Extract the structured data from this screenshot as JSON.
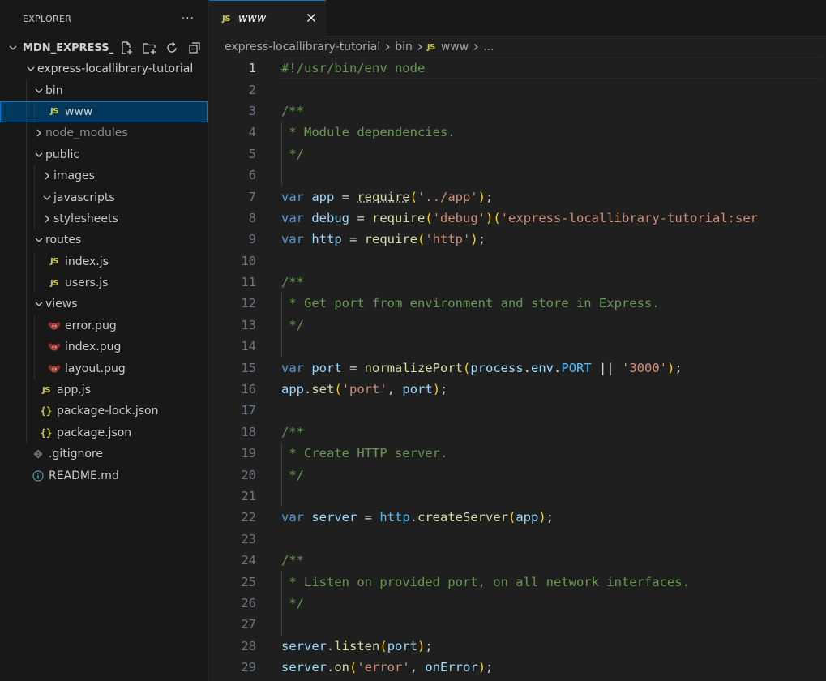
{
  "sidebar": {
    "title": "EXPLORER",
    "more_actions": "···",
    "workspace": {
      "name": "MDN_EXPRESS_...",
      "actions": [
        {
          "name": "new-file-icon"
        },
        {
          "name": "new-folder-icon"
        },
        {
          "name": "refresh-icon"
        },
        {
          "name": "collapse-all-icon"
        }
      ]
    },
    "tree": [
      {
        "label": "express-locallibrary-tutorial",
        "depth": 1,
        "kind": "folder",
        "open": true,
        "name": "express-locallibrary-tutorial"
      },
      {
        "label": "bin",
        "depth": 2,
        "kind": "folder",
        "open": true,
        "name": "bin"
      },
      {
        "label": "www",
        "depth": 3,
        "kind": "js",
        "selected": true,
        "name": "www"
      },
      {
        "label": "node_modules",
        "depth": 2,
        "kind": "folder",
        "open": false,
        "dim": true,
        "name": "node-modules"
      },
      {
        "label": "public",
        "depth": 2,
        "kind": "folder",
        "open": true,
        "name": "public"
      },
      {
        "label": "images",
        "depth": 3,
        "kind": "folder",
        "open": false,
        "name": "images"
      },
      {
        "label": "javascripts",
        "depth": 3,
        "kind": "folder",
        "open": true,
        "name": "javascripts"
      },
      {
        "label": "stylesheets",
        "depth": 3,
        "kind": "folder",
        "open": false,
        "name": "stylesheets"
      },
      {
        "label": "routes",
        "depth": 2,
        "kind": "folder",
        "open": true,
        "name": "routes"
      },
      {
        "label": "index.js",
        "depth": 3,
        "kind": "js",
        "name": "index-js"
      },
      {
        "label": "users.js",
        "depth": 3,
        "kind": "js",
        "name": "users-js"
      },
      {
        "label": "views",
        "depth": 2,
        "kind": "folder",
        "open": true,
        "name": "views"
      },
      {
        "label": "error.pug",
        "depth": 3,
        "kind": "pug",
        "name": "error-pug"
      },
      {
        "label": "index.pug",
        "depth": 3,
        "kind": "pug",
        "name": "index-pug"
      },
      {
        "label": "layout.pug",
        "depth": 3,
        "kind": "pug",
        "name": "layout-pug"
      },
      {
        "label": "app.js",
        "depth": 2,
        "kind": "js",
        "name": "app-js"
      },
      {
        "label": "package-lock.json",
        "depth": 2,
        "kind": "json",
        "name": "package-lock-json"
      },
      {
        "label": "package.json",
        "depth": 2,
        "kind": "json",
        "name": "package-json"
      },
      {
        "label": ".gitignore",
        "depth": 1,
        "kind": "git",
        "name": "gitignore"
      },
      {
        "label": "README.md",
        "depth": 1,
        "kind": "info",
        "name": "readme-md"
      }
    ]
  },
  "editor": {
    "tab": {
      "label": "www",
      "icon": "JS"
    },
    "breadcrumb": [
      "express-locallibrary-tutorial",
      "bin",
      "www",
      "..."
    ],
    "current_line": 1,
    "lines": [
      [
        [
          "#!/usr/bin/env node",
          "comment"
        ]
      ],
      [],
      [
        [
          "/**",
          "comment"
        ]
      ],
      [
        [
          " * Module dependencies.",
          "comment"
        ]
      ],
      [
        [
          " */",
          "comment"
        ]
      ],
      [],
      [
        [
          "var",
          "keyword"
        ],
        [
          " ",
          "plain"
        ],
        [
          "app",
          "var"
        ],
        [
          " = ",
          "plain"
        ],
        [
          "require",
          "func"
        ],
        [
          "(",
          "bracket1"
        ],
        [
          "'../app'",
          "string"
        ],
        [
          ")",
          "bracket1"
        ],
        [
          ";",
          "plain"
        ]
      ],
      [
        [
          "var",
          "keyword"
        ],
        [
          " ",
          "plain"
        ],
        [
          "debug",
          "var"
        ],
        [
          " = ",
          "plain"
        ],
        [
          "require",
          "func"
        ],
        [
          "(",
          "bracket1"
        ],
        [
          "'debug'",
          "string"
        ],
        [
          ")",
          "bracket1"
        ],
        [
          "(",
          "bracket1"
        ],
        [
          "'express-locallibrary-tutorial:ser",
          "string"
        ]
      ],
      [
        [
          "var",
          "keyword"
        ],
        [
          " ",
          "plain"
        ],
        [
          "http",
          "var"
        ],
        [
          " = ",
          "plain"
        ],
        [
          "require",
          "func"
        ],
        [
          "(",
          "bracket1"
        ],
        [
          "'http'",
          "string"
        ],
        [
          ")",
          "bracket1"
        ],
        [
          ";",
          "plain"
        ]
      ],
      [],
      [
        [
          "/**",
          "comment"
        ]
      ],
      [
        [
          " * Get port from environment and store in Express.",
          "comment"
        ]
      ],
      [
        [
          " */",
          "comment"
        ]
      ],
      [],
      [
        [
          "var",
          "keyword"
        ],
        [
          " ",
          "plain"
        ],
        [
          "port",
          "var"
        ],
        [
          " = ",
          "plain"
        ],
        [
          "normalizePort",
          "func"
        ],
        [
          "(",
          "bracket1"
        ],
        [
          "process",
          "var"
        ],
        [
          ".",
          "plain"
        ],
        [
          "env",
          "var"
        ],
        [
          ".",
          "plain"
        ],
        [
          "PORT",
          "const"
        ],
        [
          " || ",
          "plain"
        ],
        [
          "'3000'",
          "string"
        ],
        [
          ")",
          "bracket1"
        ],
        [
          ";",
          "plain"
        ]
      ],
      [
        [
          "app",
          "var"
        ],
        [
          ".",
          "plain"
        ],
        [
          "set",
          "func"
        ],
        [
          "(",
          "bracket1"
        ],
        [
          "'port'",
          "string"
        ],
        [
          ", ",
          "plain"
        ],
        [
          "port",
          "var"
        ],
        [
          ")",
          "bracket1"
        ],
        [
          ";",
          "plain"
        ]
      ],
      [],
      [
        [
          "/**",
          "comment"
        ]
      ],
      [
        [
          " * Create HTTP server.",
          "comment"
        ]
      ],
      [
        [
          " */",
          "comment"
        ]
      ],
      [],
      [
        [
          "var",
          "keyword"
        ],
        [
          " ",
          "plain"
        ],
        [
          "server",
          "var"
        ],
        [
          " = ",
          "plain"
        ],
        [
          "http",
          "const"
        ],
        [
          ".",
          "plain"
        ],
        [
          "createServer",
          "func"
        ],
        [
          "(",
          "bracket1"
        ],
        [
          "app",
          "var"
        ],
        [
          ")",
          "bracket1"
        ],
        [
          ";",
          "plain"
        ]
      ],
      [],
      [
        [
          "/**",
          "comment"
        ]
      ],
      [
        [
          " * Listen on provided port, on all network interfaces.",
          "comment"
        ]
      ],
      [
        [
          " */",
          "comment"
        ]
      ],
      [],
      [
        [
          "server",
          "var"
        ],
        [
          ".",
          "plain"
        ],
        [
          "listen",
          "func"
        ],
        [
          "(",
          "bracket1"
        ],
        [
          "port",
          "var"
        ],
        [
          ")",
          "bracket1"
        ],
        [
          ";",
          "plain"
        ]
      ],
      [
        [
          "server",
          "var"
        ],
        [
          ".",
          "plain"
        ],
        [
          "on",
          "func"
        ],
        [
          "(",
          "bracket1"
        ],
        [
          "'error'",
          "string"
        ],
        [
          ", ",
          "plain"
        ],
        [
          "onError",
          "var"
        ],
        [
          ")",
          "bracket1"
        ],
        [
          ";",
          "plain"
        ]
      ]
    ]
  }
}
